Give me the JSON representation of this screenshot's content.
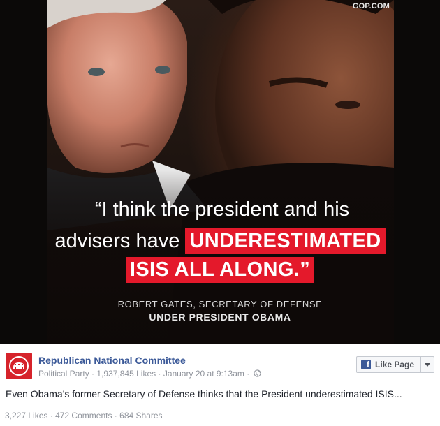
{
  "image": {
    "watermark": "GOP.COM",
    "quote": {
      "line1": "“I think the president and his",
      "line2_plain": "advisers have",
      "line2_highlight": "UNDERESTIMATED",
      "line3_highlight": "ISIS ALL ALONG.”"
    },
    "attribution": {
      "line1": "ROBERT GATES, SECRETARY OF DEFENSE",
      "line2": "UNDER PRESIDENT OBAMA"
    },
    "colors": {
      "highlight": "#e4192b",
      "background": "#0b0908"
    }
  },
  "post": {
    "page_name": "Republican National Committee",
    "category": "Political Party",
    "likes_count": "1,937,845 Likes",
    "date": "January 20 at 9:13am",
    "separator": "·",
    "privacy_icon": "globe-icon",
    "like_button_label": "Like Page",
    "text": "Even Obama's former Secretary of Defense thinks that the President underestimated ISIS...",
    "stats": {
      "likes": "3,227 Likes",
      "comments": "472 Comments",
      "shares": "684 Shares"
    },
    "colors": {
      "brand": "#3b5998",
      "logo": "#d6232b"
    }
  }
}
